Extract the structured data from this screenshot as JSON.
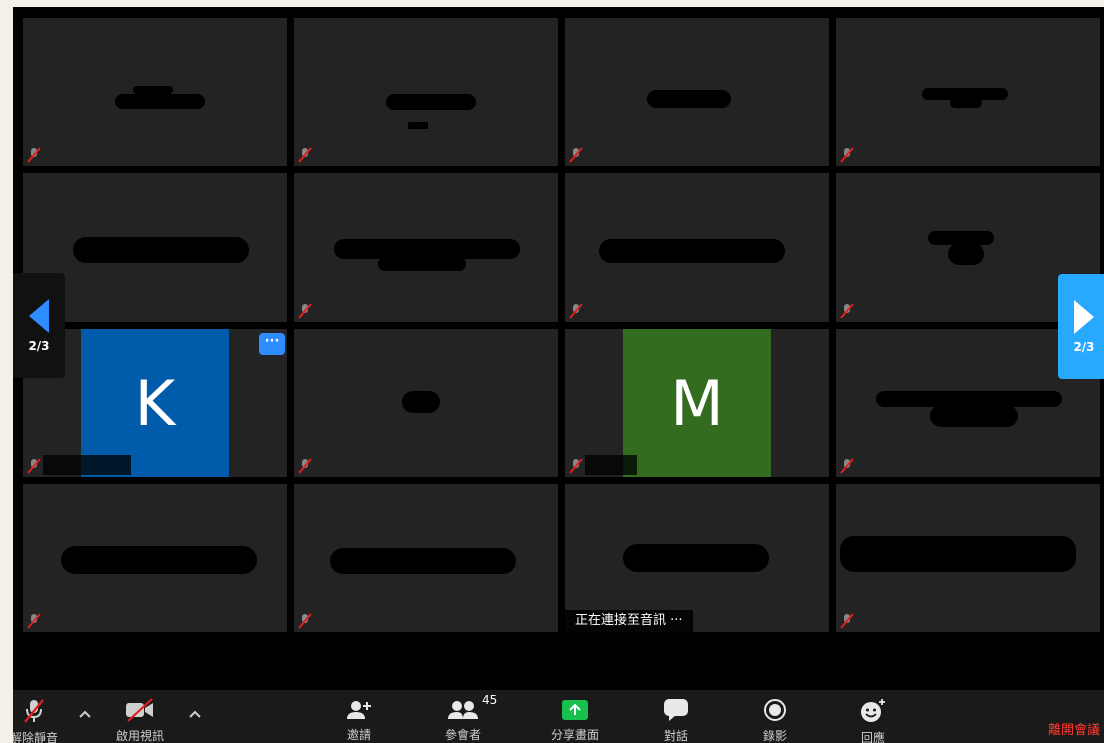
{
  "meeting": {
    "pager_label": "2/3",
    "participant_count": "45",
    "audio_status": "正在連接至音訊 ···"
  },
  "tiles": [
    {
      "avatar_letter": "K",
      "avatar_color": "#005baa"
    },
    {
      "avatar_letter": "M",
      "avatar_color": "#336b1f"
    }
  ],
  "toolbar": {
    "unmute": "解除靜音",
    "start_video": "啟用視訊",
    "invite": "邀請",
    "participants": "參會者",
    "share_screen": "分享畫面",
    "chat": "對話",
    "record": "錄影",
    "reactions": "回應",
    "leave": "離開會議"
  },
  "colors": {
    "accent": "#2d8cff",
    "pager_active": "#29a8ff",
    "share_green": "#18c04d",
    "mute_red": "#e02020",
    "leave_red": "#ff3b30"
  }
}
